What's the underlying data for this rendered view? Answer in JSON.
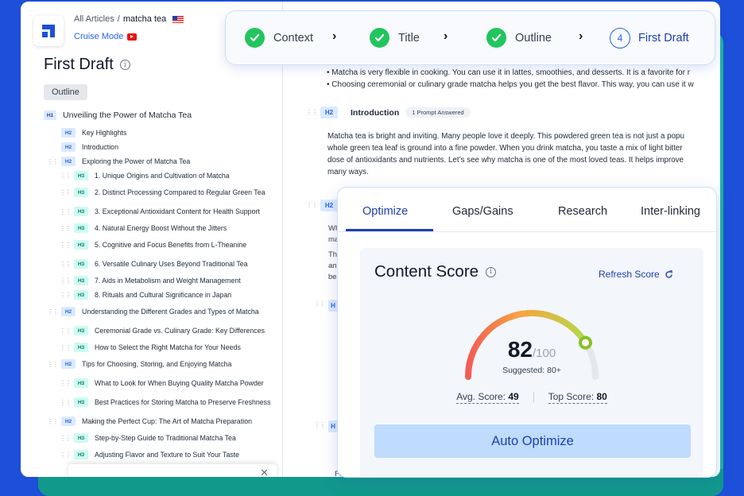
{
  "header": {
    "breadcrumb_root": "All Articles",
    "breadcrumb_sep": "/",
    "breadcrumb_current": "matcha tea",
    "cruise_mode": "Cruise Mode"
  },
  "sidebar": {
    "title": "First Draft",
    "outline_tab": "Outline",
    "items": [
      {
        "level": "H1",
        "text": "Unveiling the Power of Matcha Tea"
      },
      {
        "level": "H2",
        "text": "Key Highlights"
      },
      {
        "level": "H2",
        "text": "Introduction"
      },
      {
        "level": "H2",
        "text": "Exploring the Power of Matcha Tea"
      },
      {
        "level": "H3",
        "text": "1. Unique Origins and Cultivation of Matcha"
      },
      {
        "level": "H3",
        "text": "2. Distinct Processing Compared to Regular Green Tea"
      },
      {
        "level": "H3",
        "text": "3. Exceptional Antioxidant Content for Health Support"
      },
      {
        "level": "H3",
        "text": "4. Natural Energy Boost Without the Jitters"
      },
      {
        "level": "H3",
        "text": "5. Cognitive and Focus Benefits from L-Theanine"
      },
      {
        "level": "H3",
        "text": "6. Versatile Culinary Uses Beyond Traditional Tea"
      },
      {
        "level": "H3",
        "text": "7. Aids in Metabolism and Weight Management"
      },
      {
        "level": "H3",
        "text": "8. Rituals and Cultural Significance in Japan"
      },
      {
        "level": "H2",
        "text": "Understanding the Different Grades and Types of Matcha"
      },
      {
        "level": "H3",
        "text": "Ceremonial Grade vs. Culinary Grade: Key Differences"
      },
      {
        "level": "H3",
        "text": "How to Select the Right Matcha for Your Needs"
      },
      {
        "level": "H2",
        "text": "Tips for Choosing, Storing, and Enjoying Matcha"
      },
      {
        "level": "H3",
        "text": "What to Look for When Buying Quality Matcha Powder"
      },
      {
        "level": "H3",
        "text": "Best Practices for Storing Matcha to Preserve Freshness"
      },
      {
        "level": "H2",
        "text": "Making the Perfect Cup: The Art of Matcha Preparation"
      },
      {
        "level": "H3",
        "text": "Step-by-Step Guide to Traditional Matcha Tea"
      },
      {
        "level": "H3",
        "text": "Adjusting Flavor and Texture to Suit Your Taste"
      }
    ]
  },
  "steps": [
    {
      "label": "Context",
      "state": "done"
    },
    {
      "label": "Title",
      "state": "done"
    },
    {
      "label": "Outline",
      "state": "done"
    },
    {
      "number": "4",
      "label": "First Draft",
      "state": "active"
    }
  ],
  "editor": {
    "bullet1": "• Matcha is very flexible in cooking. You can use it in lattes, smoothies, and desserts. It is a favorite for r",
    "bullet2": "• Choosing ceremonial or culinary grade matcha helps you get the best flavor. This way, you can use it w",
    "section_tag": "H2",
    "section_title": "Introduction",
    "prompt_badge": "1 Prompt Answered",
    "para_lines": [
      "Matcha tea is bright and inviting. Many people love it deeply. This powdered green tea is not just a popu",
      "whole green tea leaf is ground into a fine powder. When you drink matcha, you taste a mix of light bitter",
      "dose of antioxidants and nutrients. Let’s see why matcha is one of the most loved teas. It helps improve",
      "many ways."
    ],
    "h2_tag_2": "H2",
    "partial_1": "Wh",
    "partial_2": "ma",
    "partial_3": "Th",
    "partial_4": "an",
    "partial_5": "be",
    "h_tag_3": "H",
    "h_tag_4": "H",
    "partial_6": "Fo"
  },
  "panel": {
    "tabs": [
      "Optimize",
      "Gaps/Gains",
      "Research",
      "Inter-linking"
    ],
    "active_tab": "Optimize",
    "content_score_title": "Content Score",
    "refresh_label": "Refresh Score",
    "score": "82",
    "score_max": "/100",
    "suggested": "Suggested: 80+",
    "avg_label": "Avg. Score:",
    "avg_value": "49",
    "top_label": "Top Score:",
    "top_value": "80",
    "auto_optimize": "Auto Optimize",
    "score_fraction": 0.82
  },
  "colors": {
    "background": "#1d4fd8",
    "accent": "#1e40af",
    "success": "#22c55e",
    "teal": "#1ab5a4"
  }
}
